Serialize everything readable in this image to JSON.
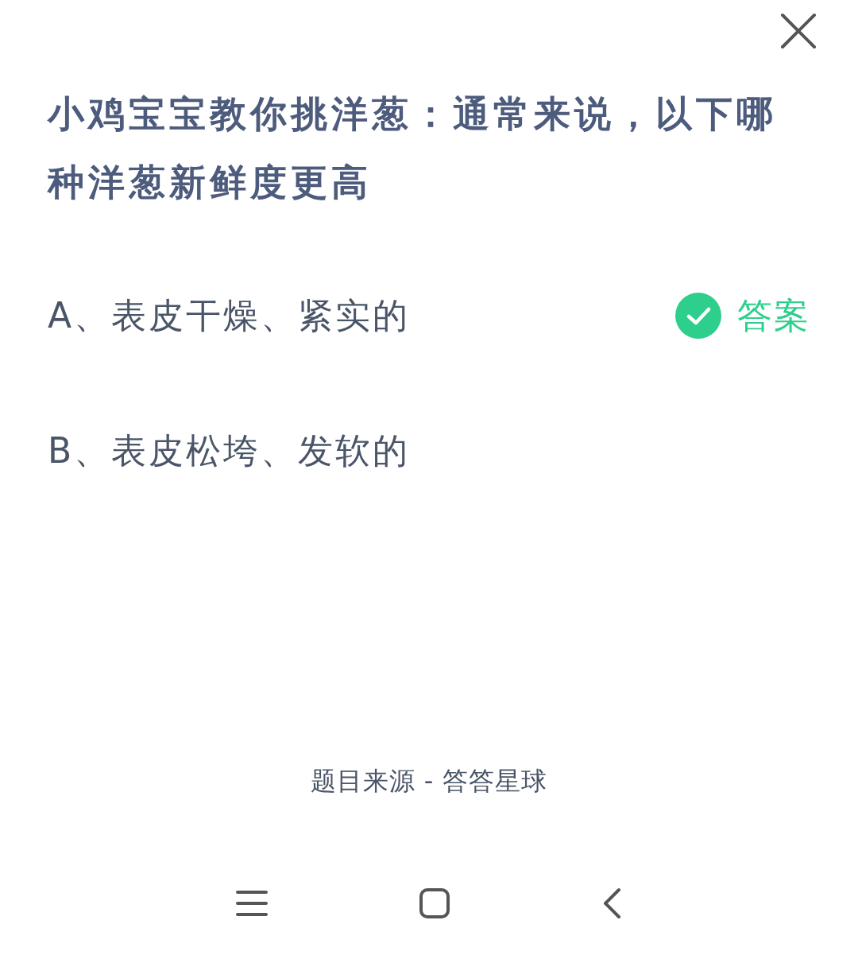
{
  "question": "小鸡宝宝教你挑洋葱：通常来说，以下哪种洋葱新鲜度更高",
  "options": [
    {
      "text": "A、表皮干燥、紧实的",
      "correct": true,
      "answer_label": "答案"
    },
    {
      "text": "B、表皮松垮、发软的",
      "correct": false
    }
  ],
  "footer": "题目来源 - 答答星球"
}
